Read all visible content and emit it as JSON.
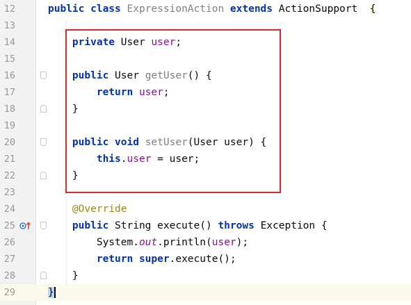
{
  "editor": {
    "lines": [
      {
        "num": "12",
        "parts": [
          {
            "t": "public ",
            "c": "kw"
          },
          {
            "t": "class ",
            "c": "kw"
          },
          {
            "t": "ExpressionAction ",
            "c": "decl"
          },
          {
            "t": "extends ",
            "c": "kw"
          },
          {
            "t": "ActionSupport  ",
            "c": ""
          },
          {
            "t": "{",
            "c": "brace-hl"
          }
        ]
      },
      {
        "num": "13",
        "parts": []
      },
      {
        "num": "14",
        "parts": [
          {
            "t": "    private ",
            "c": "kw"
          },
          {
            "t": "User ",
            "c": ""
          },
          {
            "t": "user",
            "c": "fld"
          },
          {
            "t": ";",
            "c": ""
          }
        ]
      },
      {
        "num": "15",
        "parts": []
      },
      {
        "num": "16",
        "parts": [
          {
            "t": "    public ",
            "c": "kw"
          },
          {
            "t": "User ",
            "c": ""
          },
          {
            "t": "getUser",
            "c": "decl"
          },
          {
            "t": "() {",
            "c": ""
          }
        ]
      },
      {
        "num": "17",
        "parts": [
          {
            "t": "        return ",
            "c": "kw"
          },
          {
            "t": "user",
            "c": "fld"
          },
          {
            "t": ";",
            "c": ""
          }
        ]
      },
      {
        "num": "18",
        "parts": [
          {
            "t": "    }",
            "c": ""
          }
        ]
      },
      {
        "num": "19",
        "parts": []
      },
      {
        "num": "20",
        "parts": [
          {
            "t": "    public ",
            "c": "kw"
          },
          {
            "t": "void ",
            "c": "kw"
          },
          {
            "t": "setUser",
            "c": "decl"
          },
          {
            "t": "(User user) {",
            "c": ""
          }
        ]
      },
      {
        "num": "21",
        "parts": [
          {
            "t": "        this",
            "c": "kw"
          },
          {
            "t": ".",
            "c": ""
          },
          {
            "t": "user",
            "c": "fld"
          },
          {
            "t": " = user;",
            "c": ""
          }
        ]
      },
      {
        "num": "22",
        "parts": [
          {
            "t": "    }",
            "c": ""
          }
        ]
      },
      {
        "num": "23",
        "parts": []
      },
      {
        "num": "24",
        "parts": [
          {
            "t": "    @Override",
            "c": "ann"
          }
        ]
      },
      {
        "num": "25",
        "parts": [
          {
            "t": "    public ",
            "c": "kw"
          },
          {
            "t": "String ",
            "c": ""
          },
          {
            "t": "execute",
            "c": ""
          },
          {
            "t": "() ",
            "c": ""
          },
          {
            "t": "throws ",
            "c": "kw"
          },
          {
            "t": "Exception {",
            "c": ""
          }
        ]
      },
      {
        "num": "26",
        "parts": [
          {
            "t": "        System.",
            "c": ""
          },
          {
            "t": "out",
            "c": "stat"
          },
          {
            "t": ".println(",
            "c": ""
          },
          {
            "t": "user",
            "c": "fld"
          },
          {
            "t": ");",
            "c": ""
          }
        ]
      },
      {
        "num": "27",
        "parts": [
          {
            "t": "        return ",
            "c": "kw"
          },
          {
            "t": "super",
            "c": "kw"
          },
          {
            "t": ".execute();",
            "c": ""
          }
        ]
      },
      {
        "num": "28",
        "parts": [
          {
            "t": "    }",
            "c": ""
          }
        ]
      },
      {
        "num": "29",
        "parts": [
          {
            "t": "}",
            "c": "brace-end"
          }
        ]
      }
    ],
    "fold_lines": {
      "start": [
        "16",
        "20",
        "25"
      ],
      "end": [
        "18",
        "22",
        "28"
      ]
    },
    "current_line": "29",
    "override_marker_line": "25",
    "icons": {
      "override": "override-method-icon",
      "fold": "fold-marker-icon"
    },
    "colors": {
      "highlight_box": "#e0262b",
      "keyword": "#0033b3",
      "field": "#871094",
      "annotation": "#9e880d"
    }
  }
}
